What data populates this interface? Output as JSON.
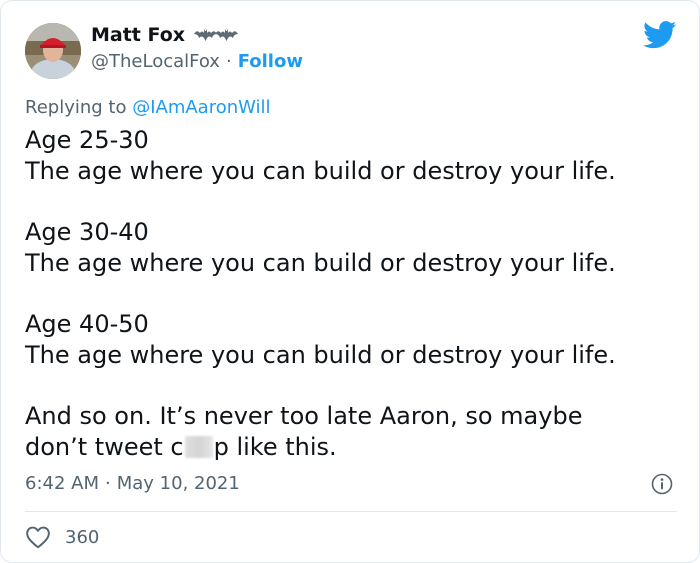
{
  "author": {
    "display_name": "Matt Fox",
    "handle": "@TheLocalFox",
    "follow_label": "Follow",
    "separator": "·"
  },
  "reply": {
    "prefix": "Replying to ",
    "mention": "@IAmAaronWill"
  },
  "tweet": {
    "lines": [
      "Age 25-30",
      "The age where you can build or destroy your life.",
      "Age 30-40",
      "The age where you can build or destroy your life.",
      "Age 40-50",
      "The age where you can build or destroy your life.",
      "And so on. It’s never too late Aaron, so maybe",
      "don’t tweet c",
      "p like this."
    ]
  },
  "meta": {
    "time": "6:42 AM",
    "separator": "·",
    "date": "May 10, 2021"
  },
  "stats": {
    "likes": "360"
  },
  "colors": {
    "accent": "#1d9bf0",
    "secondary_text": "#536471",
    "divider": "#e1e8ed"
  },
  "icons": {
    "brand": "twitter-bird-icon",
    "info": "info-icon",
    "like": "heart-icon",
    "flair": "bat-emoji-icon"
  }
}
